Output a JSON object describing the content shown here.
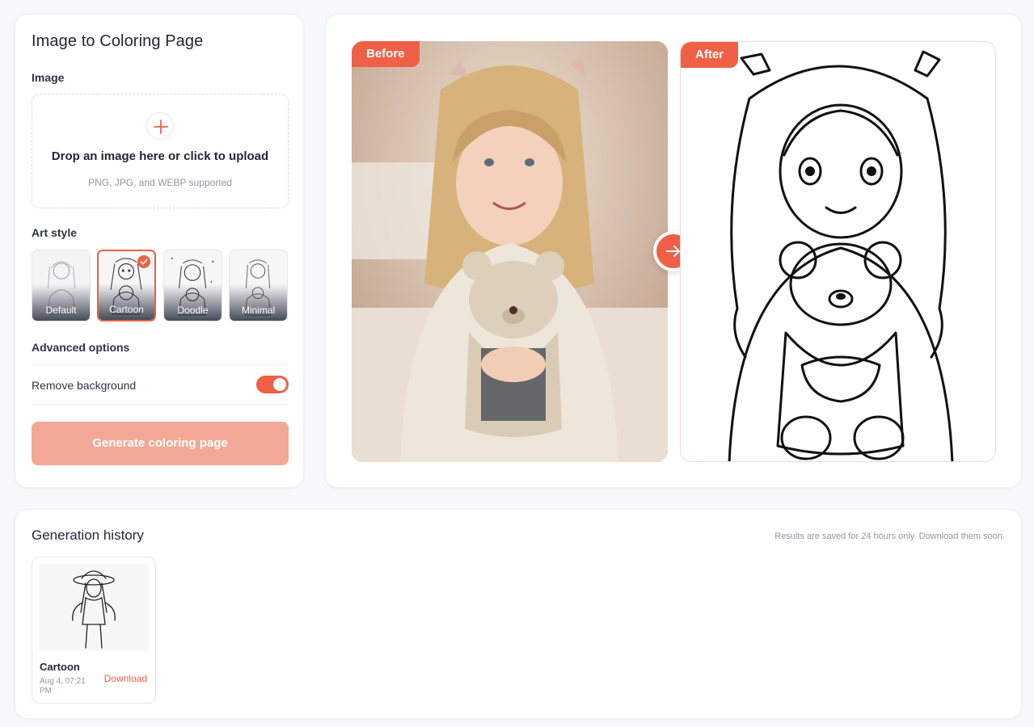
{
  "editor": {
    "title": "Image to Coloring Page",
    "image_label": "Image",
    "upload": {
      "title": "Drop an image here or click to upload",
      "subtitle": "PNG, JPG, and WEBP supported"
    },
    "art_style_label": "Art style",
    "styles": [
      {
        "label": "Default",
        "selected": false
      },
      {
        "label": "Cartoon",
        "selected": true
      },
      {
        "label": "Doodle",
        "selected": false
      },
      {
        "label": "Minimal",
        "selected": false
      }
    ],
    "advanced_label": "Advanced options",
    "remove_background_label": "Remove background",
    "remove_background_on": true,
    "generate_label": "Generate coloring page"
  },
  "preview": {
    "before_label": "Before",
    "after_label": "After"
  },
  "history": {
    "title": "Generation history",
    "note": "Results are saved for 24 hours only. Download them soon.",
    "items": [
      {
        "style": "Cartoon",
        "date": "Aug 4, 07:21 PM",
        "download_label": "Download"
      }
    ]
  },
  "colors": {
    "accent": "#ef6046",
    "accent_disabled": "#f3a897",
    "text": "#1f2533",
    "muted": "#9096a3"
  }
}
